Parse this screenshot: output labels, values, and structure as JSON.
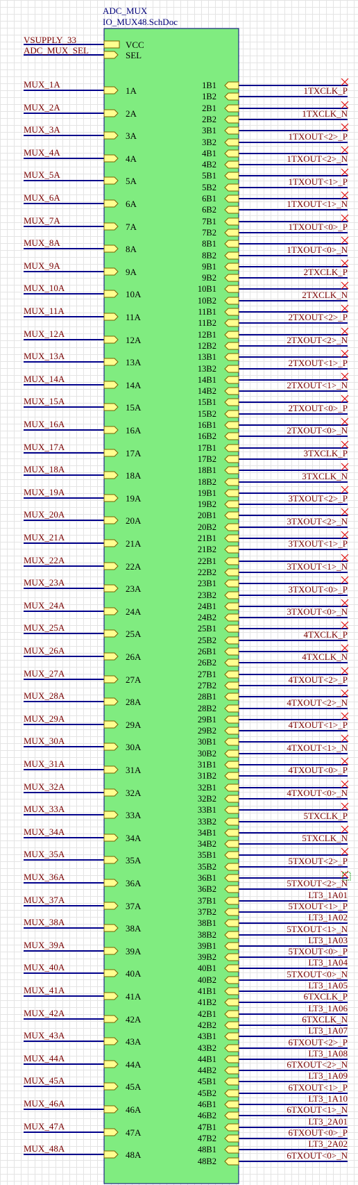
{
  "component": {
    "designator": "ADC_MUX",
    "source_file": "IO_MUX48.SchDoc",
    "body_color": "#80ec80",
    "wire_color": "#00008b",
    "net_label_color": "#7a0000"
  },
  "power_pins": [
    {
      "net": "VSUPPLY_33",
      "pin": "VCC"
    },
    {
      "net": "ADC_MUX_SEL",
      "pin": "SEL"
    }
  ],
  "left_nets": [
    "MUX_1A",
    "MUX_2A",
    "MUX_3A",
    "MUX_4A",
    "MUX_5A",
    "MUX_6A",
    "MUX_7A",
    "MUX_8A",
    "MUX_9A",
    "MUX_10A",
    "MUX_11A",
    "MUX_12A",
    "MUX_13A",
    "MUX_14A",
    "MUX_15A",
    "MUX_16A",
    "MUX_17A",
    "MUX_18A",
    "MUX_19A",
    "MUX_20A",
    "MUX_21A",
    "MUX_22A",
    "MUX_23A",
    "MUX_24A",
    "MUX_25A",
    "MUX_26A",
    "MUX_27A",
    "MUX_28A",
    "MUX_29A",
    "MUX_30A",
    "MUX_31A",
    "MUX_32A",
    "MUX_33A",
    "MUX_34A",
    "MUX_35A",
    "MUX_36A",
    "MUX_37A",
    "MUX_38A",
    "MUX_39A",
    "MUX_40A",
    "MUX_41A",
    "MUX_42A",
    "MUX_43A",
    "MUX_44A",
    "MUX_45A",
    "MUX_46A",
    "MUX_47A",
    "MUX_48A"
  ],
  "left_pins": [
    "1A",
    "2A",
    "3A",
    "4A",
    "5A",
    "6A",
    "7A",
    "8A",
    "9A",
    "10A",
    "11A",
    "12A",
    "13A",
    "14A",
    "15A",
    "16A",
    "17A",
    "18A",
    "19A",
    "20A",
    "21A",
    "22A",
    "23A",
    "24A",
    "25A",
    "26A",
    "27A",
    "28A",
    "29A",
    "30A",
    "31A",
    "32A",
    "33A",
    "34A",
    "35A",
    "36A",
    "37A",
    "38A",
    "39A",
    "40A",
    "41A",
    "42A",
    "43A",
    "44A",
    "45A",
    "46A",
    "47A",
    "48A"
  ],
  "right_pins_b1": [
    "1B1",
    "2B1",
    "3B1",
    "4B1",
    "5B1",
    "6B1",
    "7B1",
    "8B1",
    "9B1",
    "10B1",
    "11B1",
    "12B1",
    "13B1",
    "14B1",
    "15B1",
    "16B1",
    "17B1",
    "18B1",
    "19B1",
    "20B1",
    "21B1",
    "22B1",
    "23B1",
    "24B1",
    "25B1",
    "26B1",
    "27B1",
    "28B1",
    "29B1",
    "30B1",
    "31B1",
    "32B1",
    "33B1",
    "34B1",
    "35B1",
    "36B1",
    "37B1",
    "38B1",
    "39B1",
    "40B1",
    "41B1",
    "42B1",
    "43B1",
    "44B1",
    "45B1",
    "46B1",
    "47B1",
    "48B1"
  ],
  "right_pins_b2": [
    "1B2",
    "2B2",
    "3B2",
    "4B2",
    "5B2",
    "6B2",
    "7B2",
    "8B2",
    "9B2",
    "10B2",
    "11B2",
    "12B2",
    "13B2",
    "14B2",
    "15B2",
    "16B2",
    "17B2",
    "18B2",
    "19B2",
    "20B2",
    "21B2",
    "22B2",
    "23B2",
    "24B2",
    "25B2",
    "26B2",
    "27B2",
    "28B2",
    "29B2",
    "30B2",
    "31B2",
    "32B2",
    "33B2",
    "34B2",
    "35B2",
    "36B2",
    "37B2",
    "38B2",
    "39B2",
    "40B2",
    "41B2",
    "42B2",
    "43B2",
    "44B2",
    "45B2",
    "46B2",
    "47B2",
    "48B2"
  ],
  "right_nets_upper": [
    "1TXCLK_P",
    "1TXCLK_N",
    "1TXOUT<2>_P",
    "1TXOUT<2>_N",
    "1TXOUT<1>_P",
    "1TXOUT<1>_N",
    "1TXOUT<0>_P",
    "1TXOUT<0>_N",
    "2TXCLK_P",
    "2TXCLK_N",
    "2TXOUT<2>_P",
    "2TXOUT<2>_N",
    "2TXOUT<1>_P",
    "2TXOUT<1>_N",
    "2TXOUT<0>_P",
    "2TXOUT<0>_N",
    "3TXCLK_P",
    "3TXCLK_N",
    "3TXOUT<2>_P",
    "3TXOUT<2>_N",
    "3TXOUT<1>_P",
    "3TXOUT<1>_N",
    "3TXOUT<0>_P",
    "3TXOUT<0>_N",
    "4TXCLK_P",
    "4TXCLK_N",
    "4TXOUT<2>_P",
    "4TXOUT<2>_N",
    "4TXOUT<1>_P",
    "4TXOUT<1>_N",
    "4TXOUT<0>_P",
    "4TXOUT<0>_N",
    "5TXCLK_P",
    "5TXCLK_N",
    "5TXOUT<2>_P",
    "5TXOUT<2>_N"
  ],
  "right_nets_lower": [
    [
      "LT3_1A01",
      "5TXOUT<1>_P"
    ],
    [
      "LT3_1A02",
      "5TXOUT<1>_N"
    ],
    [
      "LT3_1A03",
      "5TXOUT<0>_P"
    ],
    [
      "LT3_1A04",
      "5TXOUT<0>_N"
    ],
    [
      "LT3_1A05",
      "6TXCLK_P"
    ],
    [
      "LT3_1A06",
      "6TXCLK_N"
    ],
    [
      "LT3_1A07",
      "6TXOUT<2>_P"
    ],
    [
      "LT3_1A08",
      "6TXOUT<2>_N"
    ],
    [
      "LT3_1A09",
      "6TXOUT<1>_P"
    ],
    [
      "LT3_1A10",
      "6TXOUT<1>_N"
    ],
    [
      "LT3_2A01",
      "6TXOUT<0>_P"
    ],
    [
      "LT3_2A02",
      "6TXOUT<0>_N"
    ]
  ]
}
